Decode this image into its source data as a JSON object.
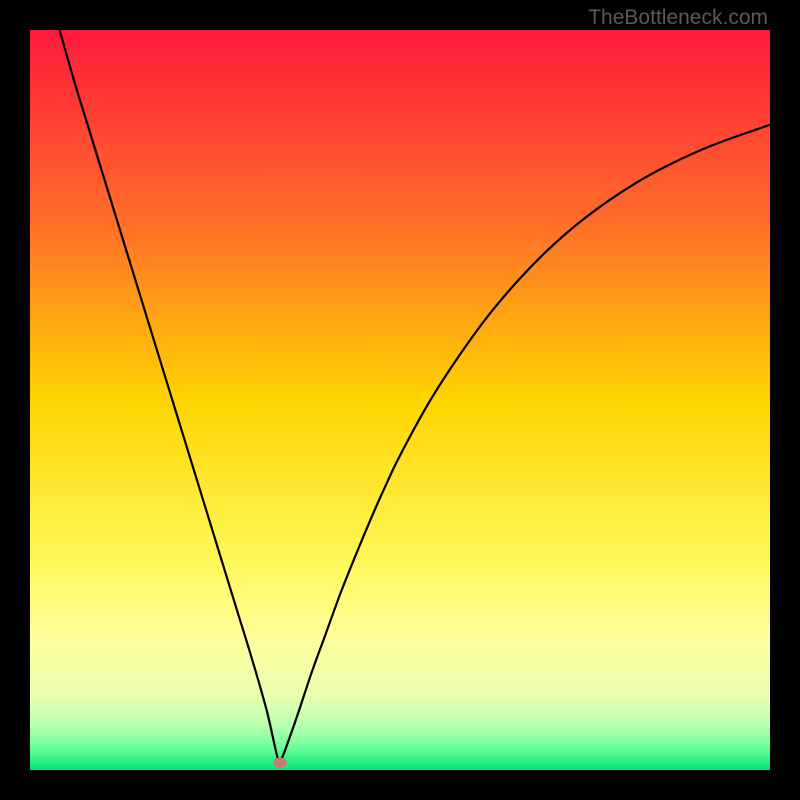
{
  "watermark": "TheBottleneck.com",
  "colors": {
    "page_bg": "#000000",
    "curve_stroke": "#000000",
    "marker_fill": "#c77a6f"
  },
  "chart_data": {
    "type": "line",
    "title": "",
    "xlabel": "",
    "ylabel": "",
    "xlim": [
      0,
      100
    ],
    "ylim": [
      0,
      100
    ],
    "series": [
      {
        "name": "bottleneck-curve",
        "x": [
          4,
          6,
          8,
          10,
          12,
          14,
          16,
          18,
          20,
          22,
          24,
          26,
          28,
          30,
          32,
          33.5,
          34,
          36,
          38,
          40,
          42,
          44,
          46,
          48,
          50,
          54,
          58,
          62,
          66,
          70,
          74,
          78,
          82,
          86,
          90,
          94,
          98,
          100
        ],
        "y": [
          100,
          93,
          86.5,
          80,
          73.5,
          67,
          60.5,
          54,
          47.5,
          41,
          34.5,
          28,
          21.5,
          15,
          8,
          1.5,
          1.5,
          7,
          13,
          18.5,
          24,
          29,
          33.8,
          38.3,
          42.5,
          49.8,
          56,
          61.5,
          66.2,
          70.3,
          73.8,
          76.8,
          79.4,
          81.6,
          83.5,
          85.1,
          86.5,
          87.2
        ]
      }
    ],
    "marker": {
      "x": 33.8,
      "y": 1.0
    },
    "gradient_stops": [
      {
        "offset": 0,
        "color": "#ff1a3a"
      },
      {
        "offset": 25,
        "color": "#ff6a2a"
      },
      {
        "offset": 50,
        "color": "#ffd400"
      },
      {
        "offset": 72,
        "color": "#fff85a"
      },
      {
        "offset": 82,
        "color": "#ffff9a"
      },
      {
        "offset": 90,
        "color": "#eaffb0"
      },
      {
        "offset": 94,
        "color": "#b9ffb0"
      },
      {
        "offset": 97,
        "color": "#6aff9a"
      },
      {
        "offset": 100,
        "color": "#00e676"
      }
    ]
  }
}
